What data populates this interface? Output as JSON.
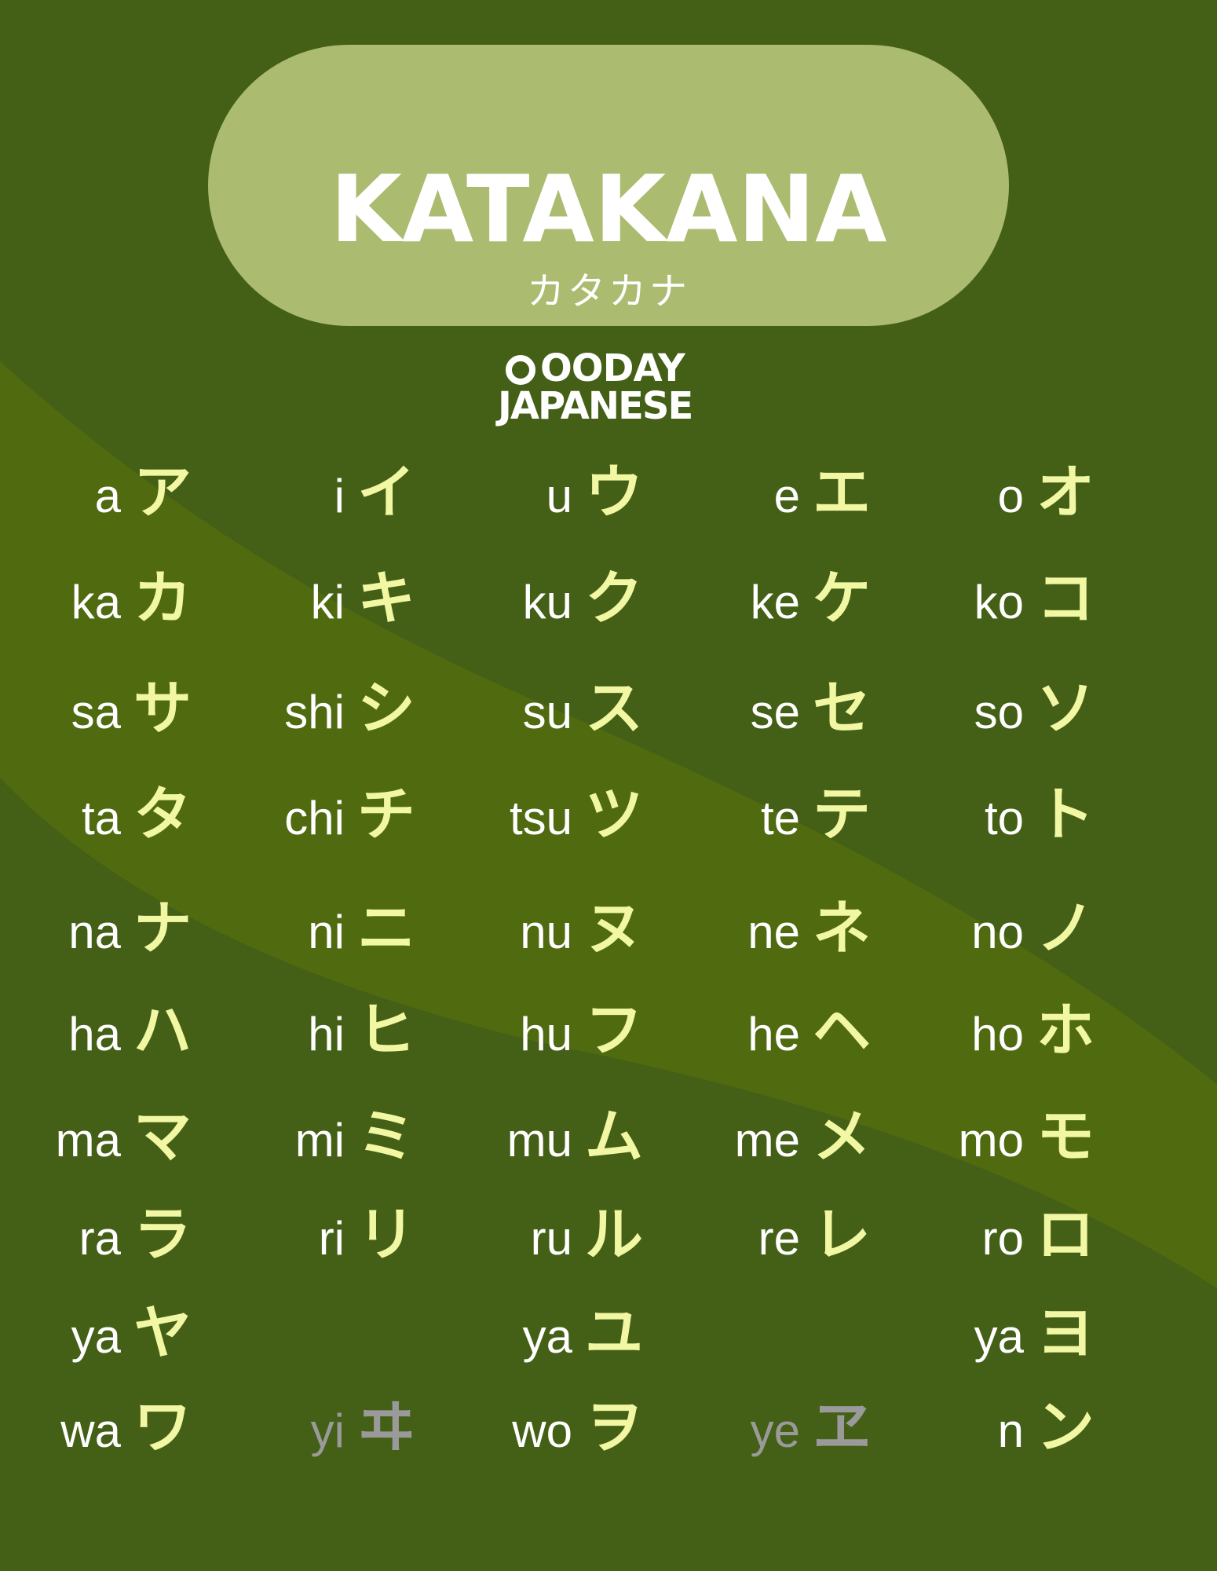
{
  "colors": {
    "background": "#445f16",
    "band": "#4f6a0f",
    "title_pill": "#abbb6f",
    "romaji": "#ffffff",
    "kana": "#f2f7a3",
    "obsolete": "#9a9a9a"
  },
  "header": {
    "title": "KATAKANA",
    "subtitle": "カタカナ"
  },
  "logo": {
    "line1": "OODAY",
    "line2": "JAPANESE"
  },
  "rows": [
    [
      {
        "romaji": "a",
        "kana": "ア"
      },
      {
        "romaji": "i",
        "kana": "イ"
      },
      {
        "romaji": "u",
        "kana": "ウ"
      },
      {
        "romaji": "e",
        "kana": "エ"
      },
      {
        "romaji": "o",
        "kana": "オ"
      }
    ],
    [
      {
        "romaji": "ka",
        "kana": "カ"
      },
      {
        "romaji": "ki",
        "kana": "キ"
      },
      {
        "romaji": "ku",
        "kana": "ク"
      },
      {
        "romaji": "ke",
        "kana": "ケ"
      },
      {
        "romaji": "ko",
        "kana": "コ"
      }
    ],
    [
      {
        "romaji": "sa",
        "kana": "サ"
      },
      {
        "romaji": "shi",
        "kana": "シ"
      },
      {
        "romaji": "su",
        "kana": "ス"
      },
      {
        "romaji": "se",
        "kana": "セ"
      },
      {
        "romaji": "so",
        "kana": "ソ"
      }
    ],
    [
      {
        "romaji": "ta",
        "kana": "タ"
      },
      {
        "romaji": "chi",
        "kana": "チ"
      },
      {
        "romaji": "tsu",
        "kana": "ツ"
      },
      {
        "romaji": "te",
        "kana": "テ"
      },
      {
        "romaji": "to",
        "kana": "ト"
      }
    ],
    [
      {
        "romaji": "na",
        "kana": "ナ"
      },
      {
        "romaji": "ni",
        "kana": "ニ"
      },
      {
        "romaji": "nu",
        "kana": "ヌ"
      },
      {
        "romaji": "ne",
        "kana": "ネ"
      },
      {
        "romaji": "no",
        "kana": "ノ"
      }
    ],
    [
      {
        "romaji": "ha",
        "kana": "ハ"
      },
      {
        "romaji": "hi",
        "kana": "ヒ"
      },
      {
        "romaji": "hu",
        "kana": "フ"
      },
      {
        "romaji": "he",
        "kana": "ヘ"
      },
      {
        "romaji": "ho",
        "kana": "ホ"
      }
    ],
    [
      {
        "romaji": "ma",
        "kana": "マ"
      },
      {
        "romaji": "mi",
        "kana": "ミ"
      },
      {
        "romaji": "mu",
        "kana": "ム"
      },
      {
        "romaji": "me",
        "kana": "メ"
      },
      {
        "romaji": "mo",
        "kana": "モ"
      }
    ],
    [
      {
        "romaji": "ra",
        "kana": "ラ"
      },
      {
        "romaji": "ri",
        "kana": "リ"
      },
      {
        "romaji": "ru",
        "kana": "ル"
      },
      {
        "romaji": "re",
        "kana": "レ"
      },
      {
        "romaji": "ro",
        "kana": "ロ"
      }
    ],
    [
      {
        "romaji": "ya",
        "kana": "ヤ"
      },
      null,
      {
        "romaji": "ya",
        "kana": "ユ"
      },
      null,
      {
        "romaji": "ya",
        "kana": "ヨ"
      }
    ],
    [
      {
        "romaji": "wa",
        "kana": "ワ"
      },
      {
        "romaji": "yi",
        "kana": "ヰ",
        "obsolete": true
      },
      {
        "romaji": "wo",
        "kana": "ヲ"
      },
      {
        "romaji": "ye",
        "kana": "ヱ",
        "obsolete": true
      },
      {
        "romaji": "n",
        "kana": "ン"
      }
    ]
  ]
}
